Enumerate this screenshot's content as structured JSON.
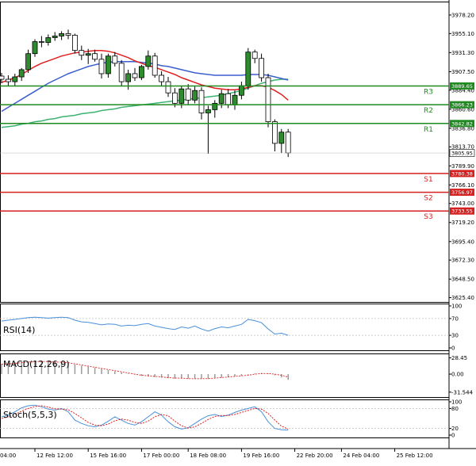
{
  "chart_data": {
    "type": "candlestick",
    "main": {
      "ylim": [
        3620.0,
        3995.0
      ],
      "y_ticks": [
        "3978.20",
        "3955.10",
        "3931.30",
        "3907.50",
        "3884.40",
        "3860.60",
        "3836.80",
        "3813.70",
        "3789.90",
        "3766.10",
        "3743.00",
        "3719.20",
        "3695.40",
        "3672.30",
        "3648.50",
        "3625.40"
      ],
      "current_price": "3805.95",
      "candles": [
        {
          "o": 3902,
          "h": 3906,
          "l": 3893,
          "c": 3898
        },
        {
          "o": 3898,
          "h": 3903,
          "l": 3890,
          "c": 3895
        },
        {
          "o": 3895,
          "h": 3905,
          "l": 3889,
          "c": 3901
        },
        {
          "o": 3901,
          "h": 3912,
          "l": 3896,
          "c": 3910
        },
        {
          "o": 3910,
          "h": 3935,
          "l": 3906,
          "c": 3930
        },
        {
          "o": 3930,
          "h": 3948,
          "l": 3926,
          "c": 3945
        },
        {
          "o": 3945,
          "h": 3952,
          "l": 3938,
          "c": 3944
        },
        {
          "o": 3944,
          "h": 3954,
          "l": 3940,
          "c": 3950
        },
        {
          "o": 3950,
          "h": 3957,
          "l": 3946,
          "c": 3952
        },
        {
          "o": 3952,
          "h": 3958,
          "l": 3947,
          "c": 3955
        },
        {
          "o": 3955,
          "h": 3960,
          "l": 3948,
          "c": 3953
        },
        {
          "o": 3953,
          "h": 3955,
          "l": 3930,
          "c": 3934
        },
        {
          "o": 3934,
          "h": 3940,
          "l": 3922,
          "c": 3928
        },
        {
          "o": 3928,
          "h": 3936,
          "l": 3917,
          "c": 3930
        },
        {
          "o": 3930,
          "h": 3935,
          "l": 3920,
          "c": 3923
        },
        {
          "o": 3923,
          "h": 3930,
          "l": 3899,
          "c": 3905
        },
        {
          "o": 3905,
          "h": 3930,
          "l": 3900,
          "c": 3927
        },
        {
          "o": 3927,
          "h": 3932,
          "l": 3914,
          "c": 3918
        },
        {
          "o": 3918,
          "h": 3922,
          "l": 3889,
          "c": 3895
        },
        {
          "o": 3895,
          "h": 3910,
          "l": 3885,
          "c": 3905
        },
        {
          "o": 3905,
          "h": 3912,
          "l": 3896,
          "c": 3900
        },
        {
          "o": 3900,
          "h": 3916,
          "l": 3897,
          "c": 3914
        },
        {
          "o": 3914,
          "h": 3934,
          "l": 3910,
          "c": 3927
        },
        {
          "o": 3927,
          "h": 3931,
          "l": 3900,
          "c": 3903
        },
        {
          "o": 3903,
          "h": 3908,
          "l": 3890,
          "c": 3895
        },
        {
          "o": 3895,
          "h": 3901,
          "l": 3876,
          "c": 3881
        },
        {
          "o": 3881,
          "h": 3887,
          "l": 3863,
          "c": 3868
        },
        {
          "o": 3868,
          "h": 3890,
          "l": 3862,
          "c": 3886
        },
        {
          "o": 3886,
          "h": 3892,
          "l": 3866,
          "c": 3872
        },
        {
          "o": 3872,
          "h": 3889,
          "l": 3868,
          "c": 3884
        },
        {
          "o": 3884,
          "h": 3888,
          "l": 3848,
          "c": 3856
        },
        {
          "o": 3856,
          "h": 3865,
          "l": 3805,
          "c": 3860
        },
        {
          "o": 3860,
          "h": 3872,
          "l": 3850,
          "c": 3868
        },
        {
          "o": 3868,
          "h": 3885,
          "l": 3862,
          "c": 3880
        },
        {
          "o": 3880,
          "h": 3886,
          "l": 3862,
          "c": 3866
        },
        {
          "o": 3866,
          "h": 3884,
          "l": 3860,
          "c": 3878
        },
        {
          "o": 3878,
          "h": 3895,
          "l": 3873,
          "c": 3890
        },
        {
          "o": 3890,
          "h": 3937,
          "l": 3885,
          "c": 3932
        },
        {
          "o": 3932,
          "h": 3935,
          "l": 3918,
          "c": 3924
        },
        {
          "o": 3924,
          "h": 3930,
          "l": 3895,
          "c": 3900
        },
        {
          "o": 3900,
          "h": 3905,
          "l": 3838,
          "c": 3845
        },
        {
          "o": 3845,
          "h": 3848,
          "l": 3808,
          "c": 3818
        },
        {
          "o": 3818,
          "h": 3836,
          "l": 3806,
          "c": 3832
        },
        {
          "o": 3832,
          "h": 3836,
          "l": 3801,
          "c": 3806
        }
      ],
      "ma_red": [
        3894,
        3897,
        3900,
        3904,
        3909,
        3914,
        3918,
        3921,
        3924,
        3927,
        3929,
        3931,
        3932,
        3933,
        3934,
        3934,
        3933,
        3931,
        3928,
        3925,
        3921,
        3918,
        3915,
        3913,
        3910,
        3907,
        3904,
        3900,
        3897,
        3894,
        3891,
        3889,
        3887,
        3886,
        3885,
        3885,
        3886,
        3888,
        3890,
        3890,
        3888,
        3884,
        3879,
        3872
      ],
      "ma_blue": [
        3858,
        3863,
        3868,
        3873,
        3878,
        3883,
        3888,
        3893,
        3897,
        3901,
        3905,
        3908,
        3911,
        3914,
        3916,
        3918,
        3919,
        3920,
        3920,
        3920,
        3920,
        3919,
        3918,
        3917,
        3915,
        3914,
        3912,
        3910,
        3908,
        3906,
        3905,
        3904,
        3903,
        3903,
        3903,
        3903,
        3903,
        3904,
        3904,
        3904,
        3903,
        3901,
        3899,
        3897
      ],
      "ma_green": [
        3838,
        3839,
        3840,
        3842,
        3843,
        3845,
        3846,
        3848,
        3849,
        3851,
        3852,
        3853,
        3855,
        3856,
        3857,
        3859,
        3860,
        3861,
        3863,
        3864,
        3865,
        3866,
        3867,
        3868,
        3869,
        3870,
        3871,
        3872,
        3873,
        3874,
        3875,
        3876,
        3877,
        3878,
        3880,
        3882,
        3884,
        3887,
        3890,
        3893,
        3895,
        3897,
        3898,
        3898
      ],
      "levels": [
        {
          "name": "R3",
          "value": 3889.65,
          "label": "3889.65",
          "kind": "resistance"
        },
        {
          "name": "R2",
          "value": 3866.23,
          "label": "3866.23",
          "kind": "resistance"
        },
        {
          "name": "R1",
          "value": 3842.82,
          "label": "3842.82",
          "kind": "resistance"
        },
        {
          "name": "S1",
          "value": 3780.38,
          "label": "3780.38",
          "kind": "support"
        },
        {
          "name": "S2",
          "value": 3756.97,
          "label": "3756.97",
          "kind": "support"
        },
        {
          "name": "S3",
          "value": 3733.55,
          "label": "3733.55",
          "kind": "support"
        }
      ]
    },
    "rsi": {
      "label": "RSI(14)",
      "ylim": [
        0,
        100
      ],
      "y_ticks": [
        "100",
        "70",
        "30",
        "0"
      ],
      "values": [
        64,
        66,
        68,
        70,
        72,
        73,
        72,
        71,
        72,
        73,
        72,
        66,
        62,
        61,
        58,
        55,
        57,
        56,
        52,
        54,
        53,
        56,
        58,
        52,
        49,
        46,
        44,
        50,
        47,
        52,
        45,
        40,
        46,
        50,
        48,
        52,
        56,
        68,
        65,
        60,
        45,
        33,
        35,
        30
      ]
    },
    "macd": {
      "label": "MACD(12,26,9)",
      "y_ticks": [
        "28.45",
        "0.00",
        "-31.544"
      ],
      "ylim": [
        -36,
        32
      ],
      "hist": [
        18,
        19,
        20,
        21,
        22,
        23,
        23,
        22,
        21,
        20,
        19,
        17,
        15,
        13,
        11,
        9,
        7,
        5,
        3,
        1,
        -1,
        -3,
        -4,
        -5,
        -6,
        -7,
        -8,
        -8,
        -8,
        -8,
        -8,
        -8,
        -7,
        -6,
        -5,
        -4,
        -3,
        -1,
        1,
        2,
        1,
        -2,
        -6,
        -10
      ],
      "signal": [
        17,
        18,
        19,
        20,
        21,
        22,
        22,
        22,
        21,
        21,
        20,
        18,
        16,
        14,
        12,
        10,
        8,
        6,
        4,
        2,
        0,
        -2,
        -3,
        -4,
        -5,
        -6,
        -7,
        -7,
        -8,
        -8,
        -8,
        -8,
        -7,
        -6,
        -5,
        -4,
        -3,
        -2,
        0,
        1,
        1,
        0,
        -2,
        -5
      ]
    },
    "stoch": {
      "label": "Stoch(5,5,3)",
      "ylim": [
        0,
        100
      ],
      "y_ticks": [
        "100",
        "80",
        "20",
        "0"
      ],
      "k": [
        55,
        60,
        70,
        82,
        88,
        90,
        85,
        78,
        75,
        80,
        70,
        45,
        35,
        28,
        25,
        30,
        42,
        55,
        45,
        35,
        30,
        40,
        55,
        70,
        60,
        40,
        25,
        18,
        22,
        35,
        48,
        58,
        62,
        56,
        60,
        68,
        75,
        80,
        85,
        70,
        40,
        20,
        16,
        15
      ],
      "d": [
        50,
        55,
        62,
        72,
        80,
        86,
        88,
        84,
        79,
        78,
        76,
        65,
        52,
        38,
        30,
        28,
        33,
        43,
        48,
        45,
        38,
        35,
        42,
        55,
        62,
        58,
        42,
        28,
        21,
        25,
        35,
        47,
        56,
        59,
        59,
        62,
        68,
        74,
        80,
        78,
        65,
        45,
        27,
        18
      ]
    },
    "x_labels": [
      "04:00",
      "12 Feb 12:00",
      "15 Feb 16:00",
      "17 Feb 00:00",
      "18 Feb 08:00",
      "19 Feb 16:00",
      "22 Feb 20:00",
      "24 Feb 04:00",
      "25 Feb 12:00"
    ],
    "x_label_candle": [
      -2,
      5,
      13,
      21,
      28,
      36,
      44,
      51,
      59
    ]
  },
  "colors": {
    "bull_candle": "#2e8b2e",
    "bear_candle": "#ffffff",
    "ma_red": "#e02020",
    "ma_blue": "#3a5fcd",
    "ma_green": "#3cb371",
    "resistance": "#1f8a1f",
    "support": "#d62020",
    "rsi_line": "#4a90d9",
    "macd_signal": "#e02020",
    "stoch_k": "#4a90d9",
    "stoch_d": "#e02020",
    "grid": "#d8d8d8",
    "axis": "#000000"
  }
}
